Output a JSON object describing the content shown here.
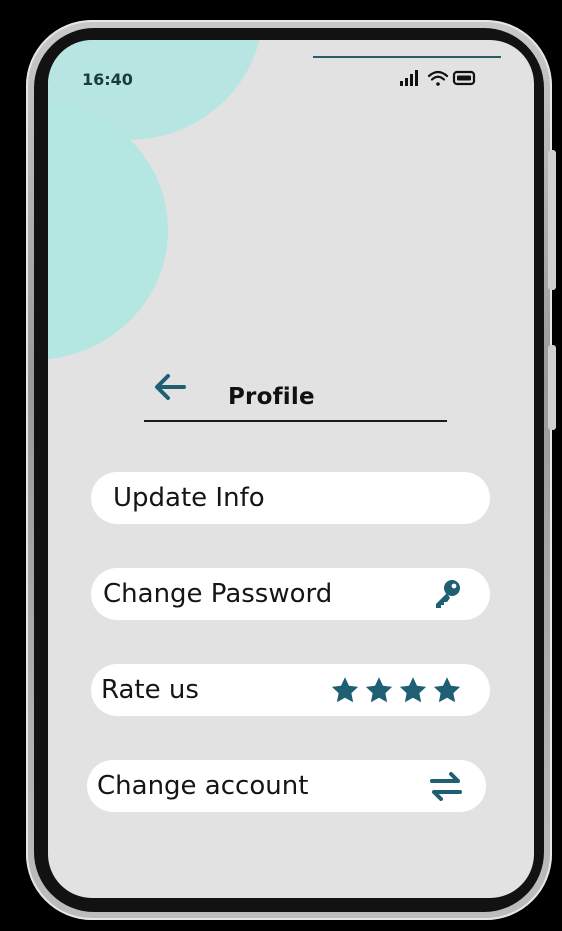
{
  "status_bar": {
    "time": "16:40",
    "icons": [
      "signal-icon",
      "wifi-icon",
      "battery-icon"
    ]
  },
  "header": {
    "back_icon": "arrow-left-icon",
    "title": "Profile"
  },
  "menu": {
    "items": [
      {
        "label": "Update Info",
        "icon": null
      },
      {
        "label": "Change Password",
        "icon": "key-icon"
      },
      {
        "label": "Rate us",
        "icon": "star-icon",
        "rating": 4
      },
      {
        "label": "Change account",
        "icon": "swap-arrows-icon"
      }
    ]
  },
  "colors": {
    "accent": "#1e5f74",
    "screen_background": "#e2e2e2",
    "decor_circle": "#b7e6e2",
    "pill_background": "#ffffff",
    "title_text": "#111111"
  }
}
